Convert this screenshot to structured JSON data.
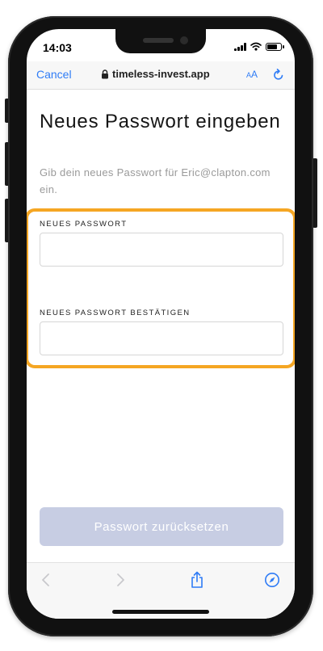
{
  "status_bar": {
    "time": "14:03",
    "icons": [
      "signal-icon",
      "wifi-icon",
      "battery-icon"
    ]
  },
  "browser": {
    "cancel_label": "Cancel",
    "address": "timeless-invest.app",
    "text_size_label_small": "A",
    "text_size_label_large": "A",
    "accent_color": "#2f7cf6",
    "icons": [
      "lock-icon",
      "reload-icon",
      "back-arrow-icon",
      "forward-arrow-icon",
      "share-icon",
      "compass-icon"
    ]
  },
  "page": {
    "title": "Neues Passwort eingeben",
    "subtitle": "Gib dein neues Passwort für Eric@clapton.com ein.",
    "fields": {
      "new_password": {
        "label": "NEUES PASSWORT",
        "value": "",
        "placeholder": ""
      },
      "confirm_password": {
        "label": "NEUES PASSWORT BESTÄTIGEN",
        "value": "",
        "placeholder": ""
      }
    },
    "submit_label": "Passwort zurücksetzen",
    "highlight_color": "#f5a623",
    "button_color": "#c7cde3"
  }
}
